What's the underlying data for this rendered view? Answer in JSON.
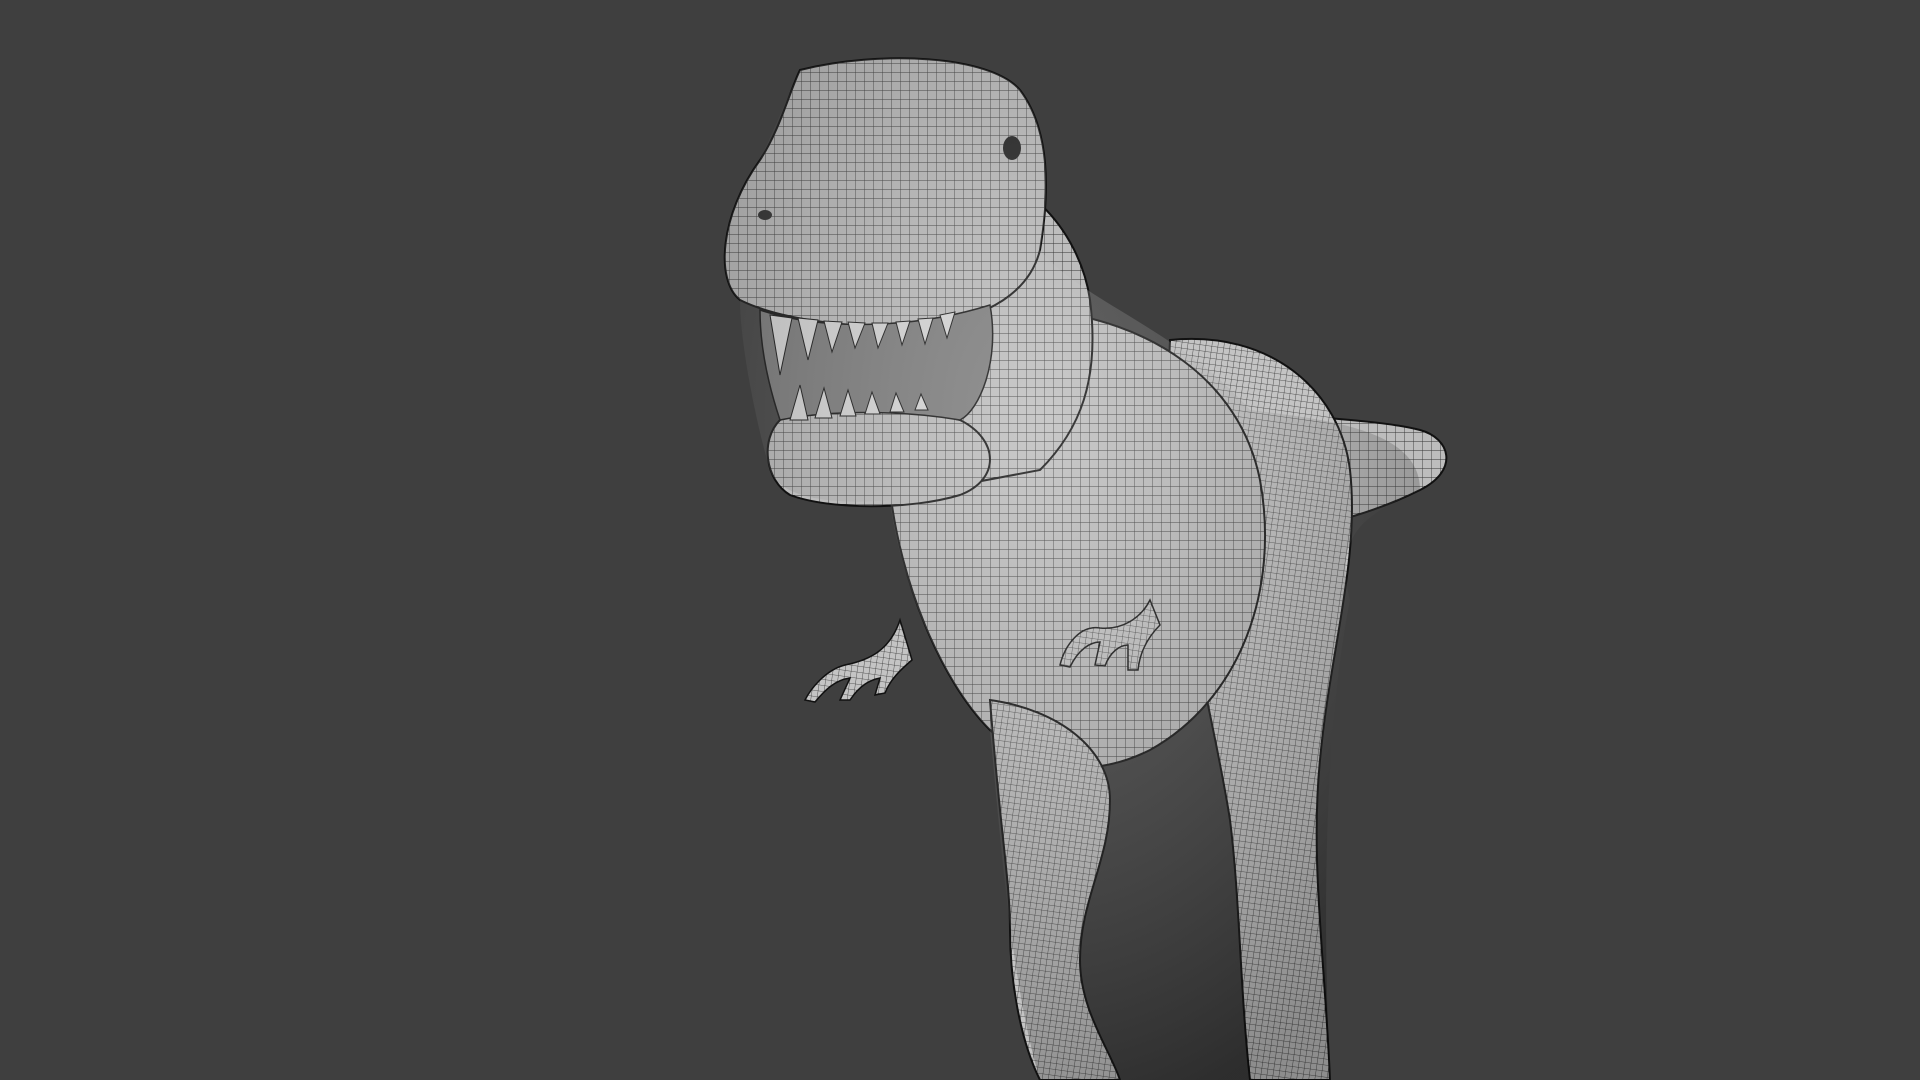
{
  "viewport": {
    "background": "#3f3f3f",
    "object": {
      "kind": "wireframe mesh",
      "subject": "t-rex-model",
      "mesh_fill": "#bdbdbd",
      "wire_color": "#1c1c1c",
      "shading": "solid-with-wireframe-overlay"
    }
  }
}
